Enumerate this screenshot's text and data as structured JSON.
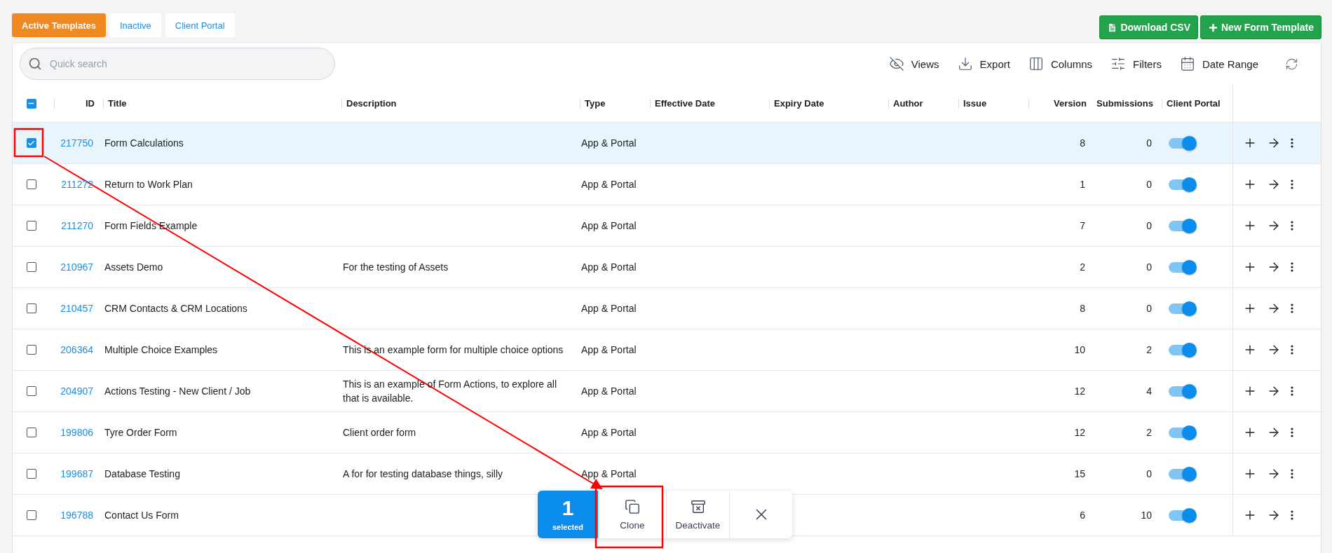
{
  "tabs": [
    {
      "label": "Active Templates",
      "selected": true
    },
    {
      "label": "Inactive",
      "selected": false
    },
    {
      "label": "Client Portal",
      "selected": false
    }
  ],
  "header_buttons": [
    {
      "kind": "file",
      "label": "Download CSV"
    },
    {
      "kind": "plus",
      "label": "New Form Template"
    }
  ],
  "search": {
    "placeholder": "Quick search"
  },
  "toolbar": [
    {
      "kind": "views",
      "label": "Views"
    },
    {
      "kind": "export",
      "label": "Export"
    },
    {
      "kind": "columns",
      "label": "Columns"
    },
    {
      "kind": "filters",
      "label": "Filters"
    },
    {
      "kind": "date_range",
      "label": "Date Range"
    },
    {
      "kind": "refresh"
    }
  ],
  "table": {
    "partial_selection": true,
    "columns": [
      "ID",
      "Title",
      "Description",
      "Type",
      "Effective Date",
      "Expiry Date",
      "Author",
      "Issue",
      "Version",
      "Submissions",
      "Client Portal"
    ],
    "rows": [
      {
        "id": "217750",
        "title": "Form Calculations",
        "type": "App & Portal",
        "version": "8",
        "submissions": "0",
        "client_portal": true,
        "selected": true
      },
      {
        "id": "211272",
        "title": "Return to Work Plan",
        "type": "App & Portal",
        "version": "1",
        "submissions": "0",
        "client_portal": true,
        "selected": false
      },
      {
        "id": "211270",
        "title": "Form Fields Example",
        "type": "App & Portal",
        "version": "7",
        "submissions": "0",
        "client_portal": true,
        "selected": false
      },
      {
        "id": "210967",
        "title": "Assets Demo",
        "description": "For the testing of Assets",
        "type": "App & Portal",
        "version": "2",
        "submissions": "0",
        "client_portal": true,
        "selected": false
      },
      {
        "id": "210457",
        "title": "CRM Contacts & CRM Locations",
        "type": "App & Portal",
        "version": "8",
        "submissions": "0",
        "client_portal": true,
        "selected": false
      },
      {
        "id": "206364",
        "title": "Multiple Choice Examples",
        "description": "This is an example form for multiple choice options",
        "type": "App & Portal",
        "version": "10",
        "submissions": "2",
        "client_portal": true,
        "selected": false
      },
      {
        "id": "204907",
        "title": "Actions Testing - New Client / Job",
        "description": "This is an example of Form Actions, to explore all that is available.",
        "type": "App & Portal",
        "version": "12",
        "submissions": "4",
        "client_portal": true,
        "selected": false
      },
      {
        "id": "199806",
        "title": "Tyre Order Form",
        "description": "Client order form",
        "type": "App & Portal",
        "version": "12",
        "submissions": "2",
        "client_portal": true,
        "selected": false
      },
      {
        "id": "199687",
        "title": "Database Testing",
        "description": "A for for testing database things, silly",
        "type": "App & Portal",
        "version": "15",
        "submissions": "0",
        "client_portal": true,
        "selected": false
      },
      {
        "id": "196788",
        "title": "Contact Us Form",
        "version": "6",
        "submissions": "10",
        "client_portal": true,
        "selected": false
      }
    ]
  },
  "bulk_bar": {
    "count": "1",
    "count_label": "selected",
    "actions": [
      {
        "kind": "clone",
        "label": "Clone"
      },
      {
        "kind": "deactivate",
        "label": "Deactivate"
      },
      {
        "kind": "close"
      }
    ]
  },
  "annotation": {
    "kind": "arrow-and-boxes"
  }
}
